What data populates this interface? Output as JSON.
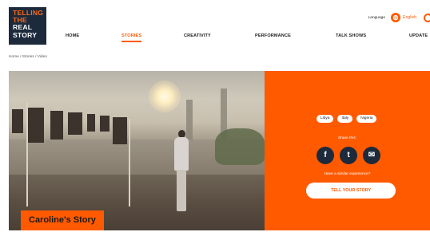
{
  "brand": {
    "logo_lines": [
      "TELLING",
      "THE",
      "REAL",
      "STORY"
    ],
    "accent_color": "#ff5a00",
    "navy_color": "#1c2a3c"
  },
  "header": {
    "language_label": "Language",
    "language_value": "English",
    "globe_icon": "globe-icon",
    "search_icon": "search-icon"
  },
  "nav": {
    "items": [
      {
        "label": "HOME",
        "active": false
      },
      {
        "label": "STORIES",
        "active": true
      },
      {
        "label": "CREATIVITY",
        "active": false
      },
      {
        "label": "PERFORMANCE",
        "active": false
      },
      {
        "label": "TALK SHOWS",
        "active": false
      },
      {
        "label": "UPDATE",
        "active": false
      }
    ]
  },
  "breadcrumb": {
    "items": [
      "Home",
      "Stories",
      "Video"
    ],
    "separator": " / "
  },
  "story": {
    "title": "Caroline's Story",
    "tags": [
      "Libya",
      "Italy",
      "Nigeria"
    ],
    "share_label": "Share this:",
    "share_buttons": [
      {
        "name": "facebook-icon",
        "glyph": "f"
      },
      {
        "name": "twitter-icon",
        "glyph": "t"
      },
      {
        "name": "email-icon",
        "glyph": "✉"
      }
    ],
    "experience_label": "Have a similar experience?",
    "cta_label": "TELL YOUR STORY"
  }
}
